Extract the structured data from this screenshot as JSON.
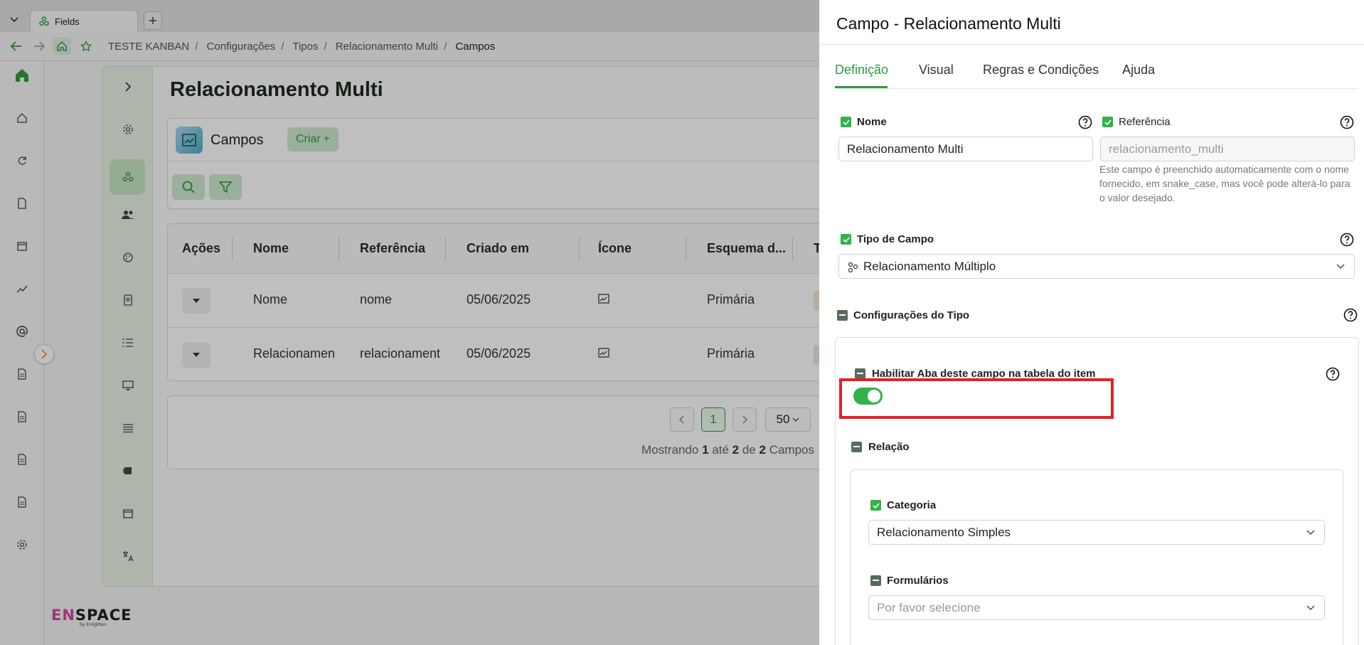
{
  "browser": {
    "tab_title": "Fields",
    "breadcrumb": [
      "TESTE KANBAN",
      "Configurações",
      "Tipos",
      "Relacionamento Multi",
      "Campos"
    ]
  },
  "page": {
    "title": "Relacionamento Multi",
    "card_title": "Campos",
    "create_label": "Criar",
    "logo": "ENSPACE"
  },
  "table": {
    "columns": [
      "Ações",
      "Nome",
      "Referência",
      "Criado em",
      "Ícone",
      "Esquema d...",
      "T"
    ],
    "rows": [
      {
        "nome": "Nome",
        "referencia": "nome",
        "criado": "05/06/2025",
        "esquema": "Primária"
      },
      {
        "nome": "Relacionament",
        "referencia": "relacionament",
        "criado": "05/06/2025",
        "esquema": "Primária"
      }
    ]
  },
  "pagination": {
    "current_page": "1",
    "page_size": "50",
    "info_prefix": "Mostrando",
    "from": "1",
    "mid": "até",
    "to": "2",
    "of": "de",
    "total": "2",
    "suffix": "Campos"
  },
  "panel": {
    "title": "Campo - Relacionamento Multi",
    "tabs": [
      "Definição",
      "Visual",
      "Regras e Condições",
      "Ajuda"
    ],
    "active_tab": "Definição",
    "nome": {
      "label": "Nome",
      "value": "Relacionamento Multi"
    },
    "referencia": {
      "label": "Referência",
      "placeholder": "relacionamento_multi",
      "note": "Este campo é preenchido automaticamente com o nome fornecido, em snake_case, mas você pode alterá-lo para o valor desejado."
    },
    "tipo": {
      "label": "Tipo de Campo",
      "value": "Relacionamento Múltiplo"
    },
    "config_label": "Configurações do Tipo",
    "habilitar": {
      "label": "Habilitar Aba deste campo na tabela do item",
      "enabled": true
    },
    "relacao_label": "Relação",
    "categoria": {
      "label": "Categoria",
      "value": "Relacionamento Simples"
    },
    "formularios": {
      "label": "Formulários",
      "placeholder": "Por favor selecione"
    }
  },
  "colors": {
    "accent": "#2e9b3f",
    "checkbox": "#33b24a",
    "highlight": "#e3202a"
  }
}
